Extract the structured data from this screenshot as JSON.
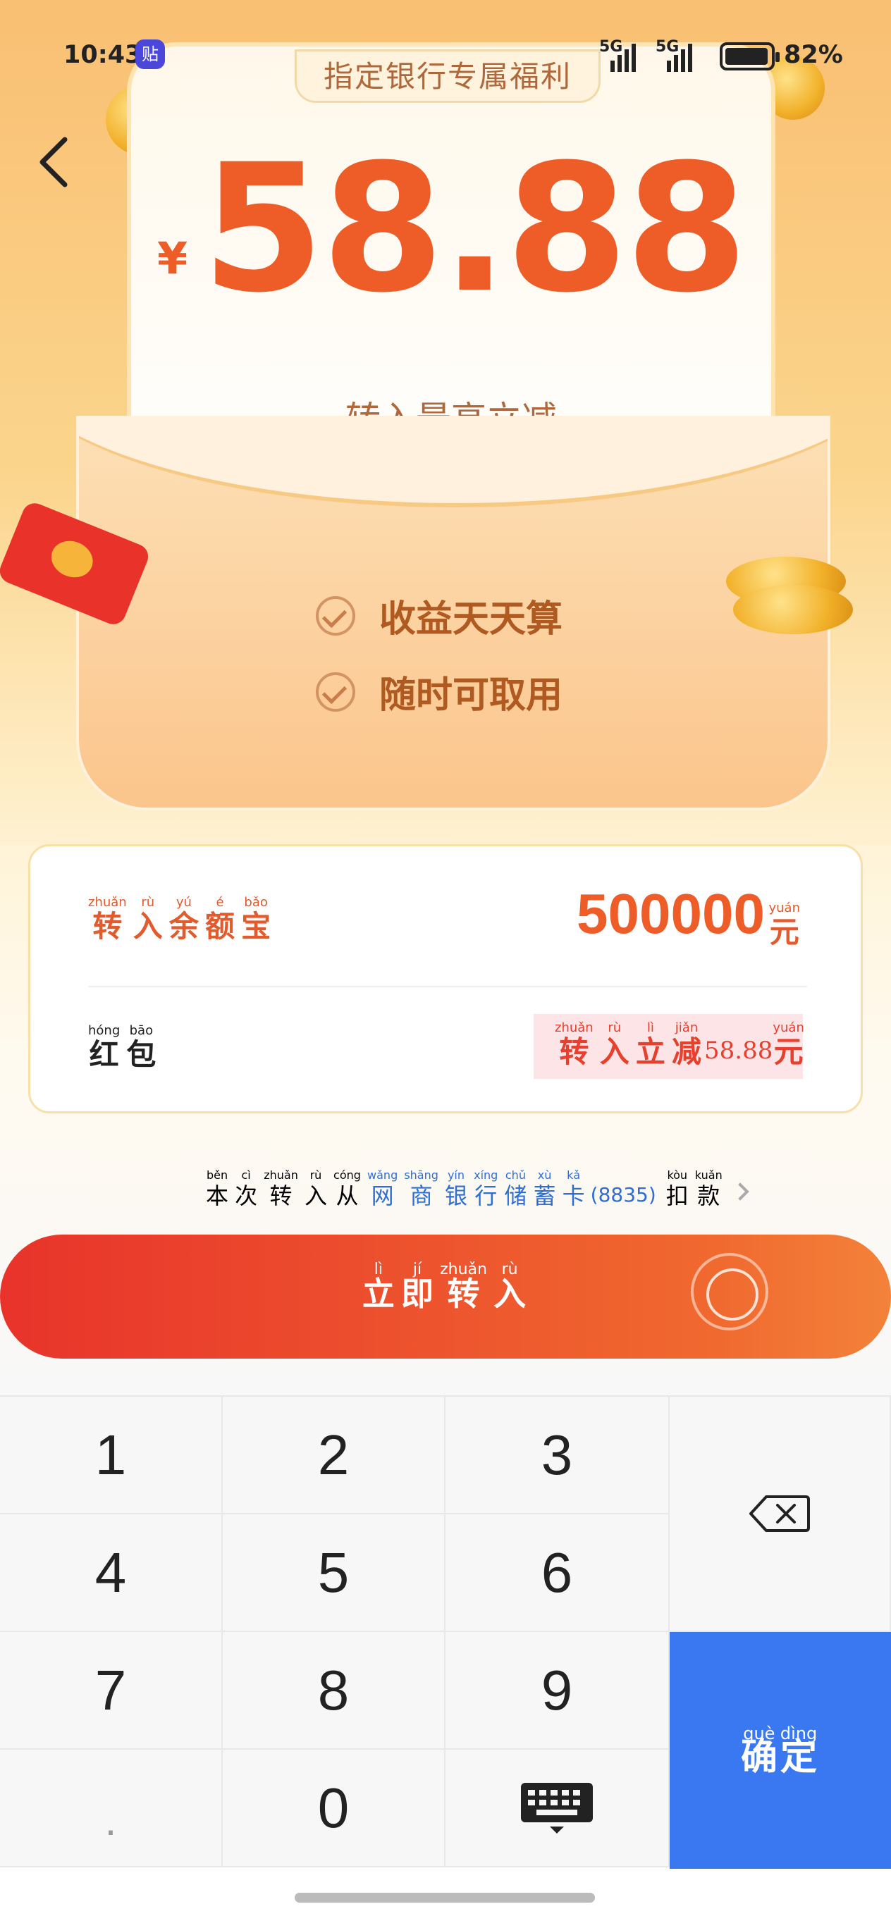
{
  "status_bar": {
    "time": "10:43",
    "app_badge": "贴",
    "network1": "5G",
    "network2": "5G",
    "battery": "82%"
  },
  "header": {
    "banner_title": "指定银行专属福利",
    "currency": "¥",
    "amount": "58.88",
    "subtitle": "转入最高立减"
  },
  "features": [
    {
      "label": "收益天天算",
      "icon": "check-circle-icon"
    },
    {
      "label": "随时可取用",
      "icon": "check-circle-icon"
    }
  ],
  "transfer_card": {
    "label": [
      {
        "py": "zhuǎn",
        "hz": "转"
      },
      {
        "py": "rù",
        "hz": "入"
      },
      {
        "py": "yú",
        "hz": "余"
      },
      {
        "py": "é",
        "hz": "额"
      },
      {
        "py": "bǎo",
        "hz": "宝"
      }
    ],
    "amount": "500000",
    "unit": {
      "py": "yuán",
      "hz": "元"
    },
    "redpacket_label": [
      {
        "py": "hóng",
        "hz": "红"
      },
      {
        "py": "bāo",
        "hz": "包"
      }
    ],
    "discount_label": [
      {
        "py": "zhuǎn",
        "hz": "转"
      },
      {
        "py": "rù",
        "hz": "入"
      },
      {
        "py": "lì",
        "hz": "立"
      },
      {
        "py": "jiǎn",
        "hz": "减"
      }
    ],
    "discount_amount": "58.88",
    "discount_unit": {
      "py": "yuán",
      "hz": "元"
    }
  },
  "source": {
    "prefix": [
      {
        "py": "běn",
        "hz": "本"
      },
      {
        "py": "cì",
        "hz": "次"
      },
      {
        "py": "zhuǎn",
        "hz": "转"
      },
      {
        "py": "rù",
        "hz": "入"
      },
      {
        "py": "cóng",
        "hz": "从"
      }
    ],
    "bank": [
      {
        "py": "wǎng",
        "hz": "网"
      },
      {
        "py": "shāng",
        "hz": "商"
      },
      {
        "py": "yín",
        "hz": "银"
      },
      {
        "py": "xíng",
        "hz": "行"
      },
      {
        "py": "chǔ",
        "hz": "储"
      },
      {
        "py": "xù",
        "hz": "蓄"
      },
      {
        "py": "kǎ",
        "hz": "卡"
      }
    ],
    "card_no": "(8835)",
    "suffix": [
      {
        "py": "kòu",
        "hz": "扣"
      },
      {
        "py": "kuǎn",
        "hz": "款"
      }
    ]
  },
  "cta": {
    "label": [
      {
        "py": "lì",
        "hz": "立"
      },
      {
        "py": "jí",
        "hz": "即"
      },
      {
        "py": "zhuǎn",
        "hz": "转"
      },
      {
        "py": "rù",
        "hz": "入"
      }
    ]
  },
  "keypad": {
    "keys": [
      "1",
      "2",
      "3",
      "4",
      "5",
      "6",
      "7",
      "8",
      "9",
      ".",
      "0"
    ],
    "confirm": [
      {
        "py": "què",
        "hz": "确"
      },
      {
        "py": "dìng",
        "hz": "定"
      }
    ]
  },
  "colors": {
    "accent": "#ee5c28",
    "confirm": "#3a78f2",
    "link": "#2d6ed8"
  }
}
